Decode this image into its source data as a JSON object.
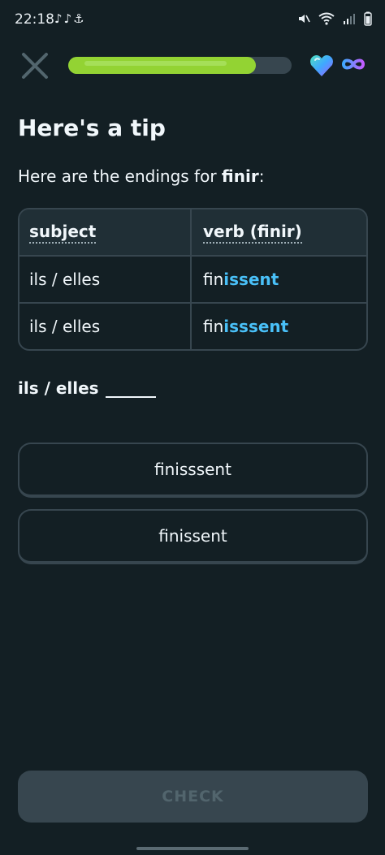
{
  "status_bar": {
    "time": "22:18",
    "app_icons": "♪♪⚓",
    "right_icons": [
      "mute-icon",
      "wifi-icon",
      "signal-icon",
      "battery-icon"
    ]
  },
  "header": {
    "progress": 0.84,
    "progress_color": "#93d333",
    "hearts_icon": "gem-heart-icon",
    "hearts_value": "infinity-icon"
  },
  "lesson": {
    "title": "Here's a tip",
    "intro_prefix": "Here are the endings for ",
    "intro_verb": "finir",
    "intro_suffix": ":"
  },
  "table": {
    "headers": [
      "subject",
      "verb (finir)"
    ],
    "rows": [
      {
        "subject": "ils / elles",
        "stem": "fin",
        "ending": "issent"
      },
      {
        "subject": "ils / elles",
        "stem": "fin",
        "ending": "isssent"
      }
    ]
  },
  "prompt": {
    "subject": "ils / elles"
  },
  "options": [
    {
      "label": "finisssent"
    },
    {
      "label": "finissent"
    }
  ],
  "footer": {
    "check_label": "CHECK"
  },
  "colors": {
    "background": "#131f24",
    "highlight": "#49c0f8",
    "border": "#37464f"
  }
}
